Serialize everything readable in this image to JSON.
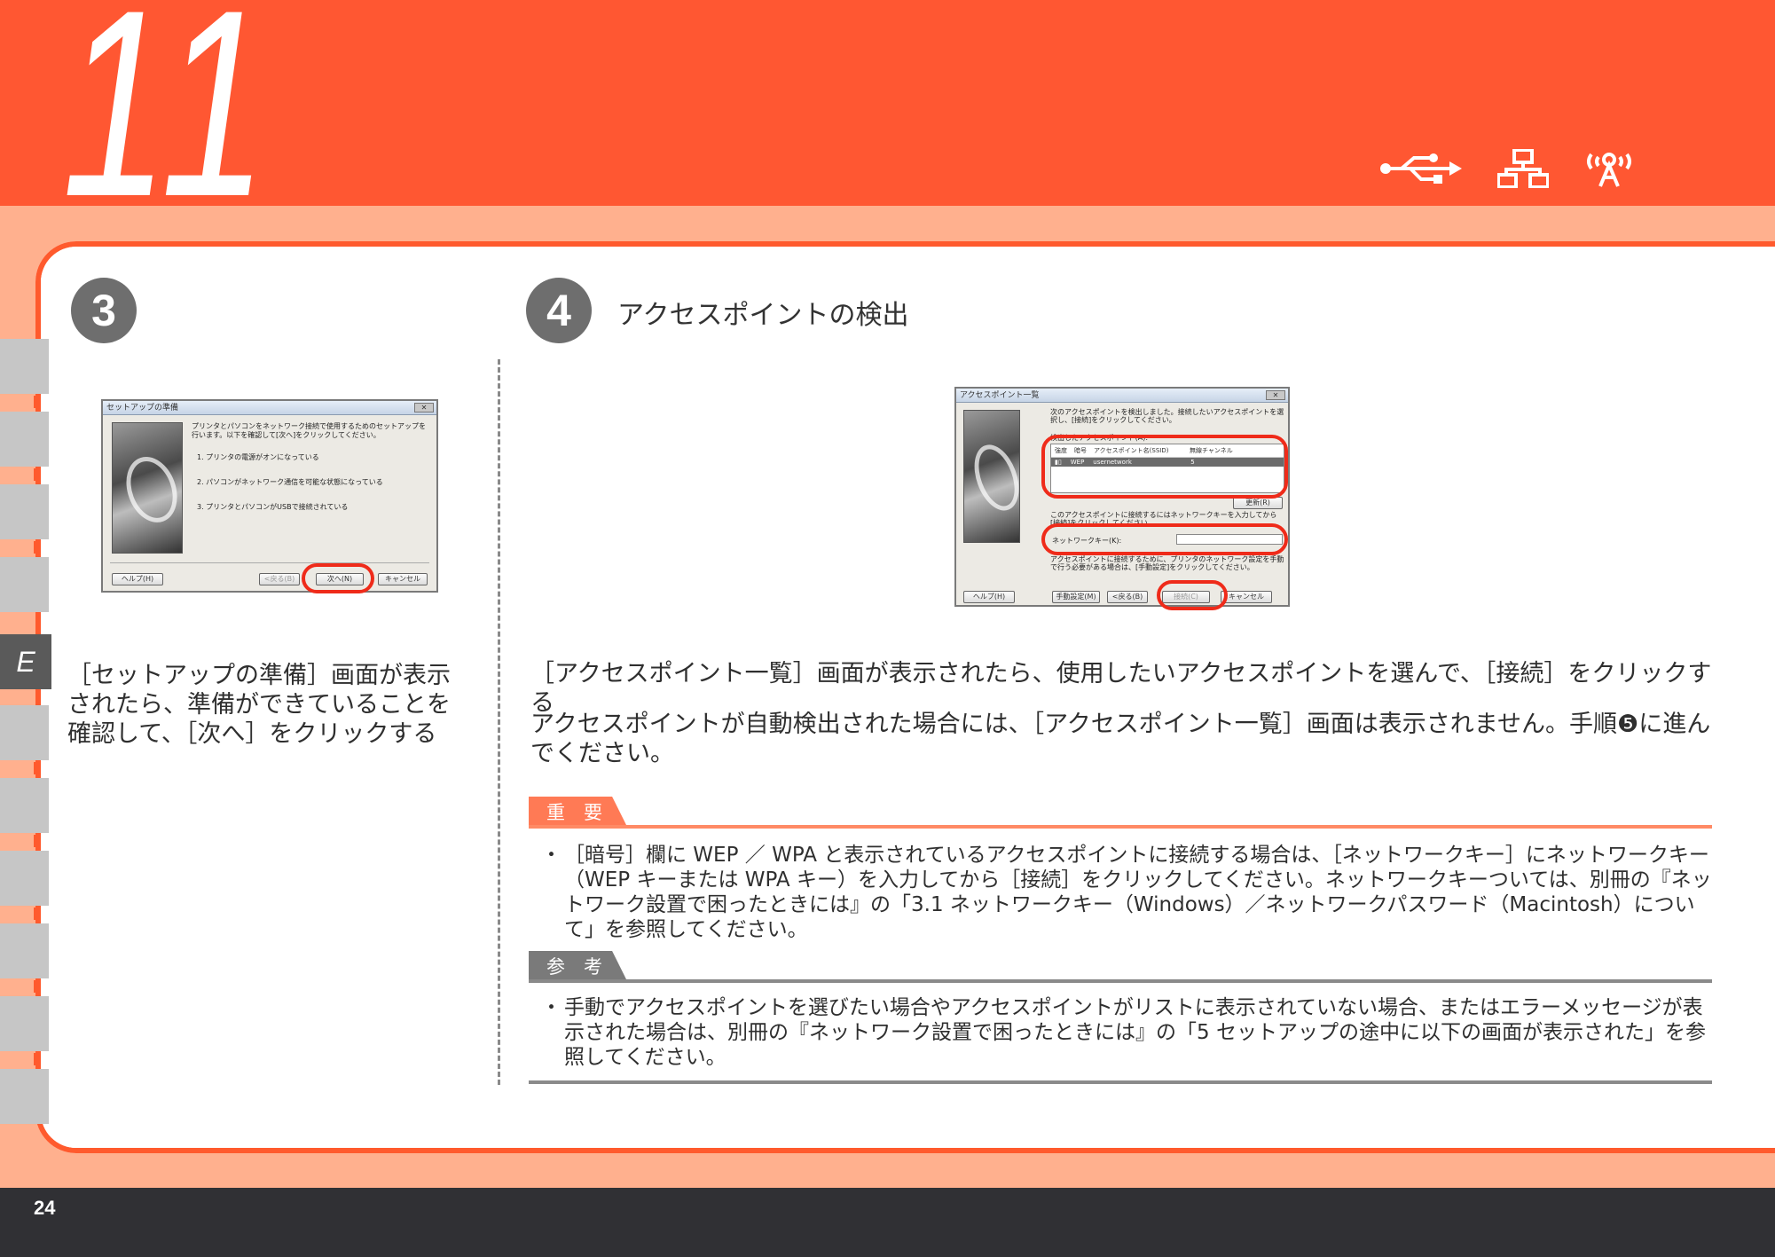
{
  "header": {
    "chapter_number": "11"
  },
  "side_tab": {
    "label": "E"
  },
  "step3": {
    "number": "3",
    "description": "［セットアップの準備］画面が表示されたら、準備ができていることを確認して、［次へ］をクリックする",
    "dialog": {
      "title": "セットアップの準備",
      "intro": "プリンタとパソコンをネットワーク接続で使用するためのセットアップを行います。以下を確認して[次へ]をクリックしてください。",
      "items": [
        "1. プリンタの電源がオンになっている",
        "2. パソコンがネットワーク通信を可能な状態になっている",
        "3. プリンタとパソコンがUSBで接続されている"
      ],
      "help_button": "ヘルプ(H)",
      "back_button": "<戻る(B)",
      "next_button": "次へ(N)",
      "cancel_button": "キャンセル"
    }
  },
  "step4": {
    "number": "4",
    "title": "アクセスポイントの検出",
    "description": "［アクセスポイント一覧］画面が表示されたら、使用したいアクセスポイントを選んで、［接続］をクリックする",
    "note": "アクセスポイントが自動検出された場合には、［アクセスポイント一覧］画面は表示されません。手順❺に進んでください。",
    "dialog": {
      "title": "アクセスポイント一覧",
      "intro": "次のアクセスポイントを検出しました。接続したいアクセスポイントを選択し、[接続]をクリックしてください。",
      "list_label": "検出したアクセスポイント(A):",
      "columns": [
        "強度",
        "暗号",
        "アクセスポイント名(SSID)",
        "無線チャンネル"
      ],
      "row": {
        "encryption": "WEP",
        "ssid": "usernetwork",
        "channel": "5"
      },
      "update_button": "更新(R)",
      "key_hint": "このアクセスポイントに接続するにはネットワークキーを入力してから[接続]をクリックしてください。",
      "key_label": "ネットワークキー(K):",
      "manual_hint": "アクセスポイントに接続するために、プリンタのネットワーク設定を手動で行う必要がある場合は、[手動設定]をクリックしてください。",
      "help_button": "ヘルプ(H)",
      "manual_button": "手動設定(M)",
      "back_button": "<戻る(B)",
      "connect_button": "接続(C)",
      "cancel_button": "キャンセル"
    }
  },
  "important": {
    "label": "重　要",
    "text": "［暗号］欄に WEP ／ WPA と表示されているアクセスポイントに接続する場合は、［ネットワークキー］にネットワークキー（WEP キーまたは WPA キー）を入力してから［接続］をクリックしてください。ネットワークキーついては、別冊の『ネットワーク設置で困ったときには』の「3.1 ネットワークキー（Windows）／ネットワークパスワード（Macintosh）について」を参照してください。"
  },
  "reference": {
    "label": "参　考",
    "text": "手動でアクセスポイントを選びたい場合やアクセスポイントがリストに表示されていない場合、またはエラーメッセージが表示された場合は、別冊の『ネットワーク設置で困ったときには』の「5 セットアップの途中に以下の画面が表示された」を参照してください。"
  },
  "footer": {
    "page_number": "24"
  },
  "icons": [
    "usb-icon",
    "network-icon",
    "wireless-icon"
  ],
  "colors": {
    "header": "#ff5732",
    "accent": "#ff5a2d",
    "background": "#ffb08e",
    "footer": "#303034"
  }
}
